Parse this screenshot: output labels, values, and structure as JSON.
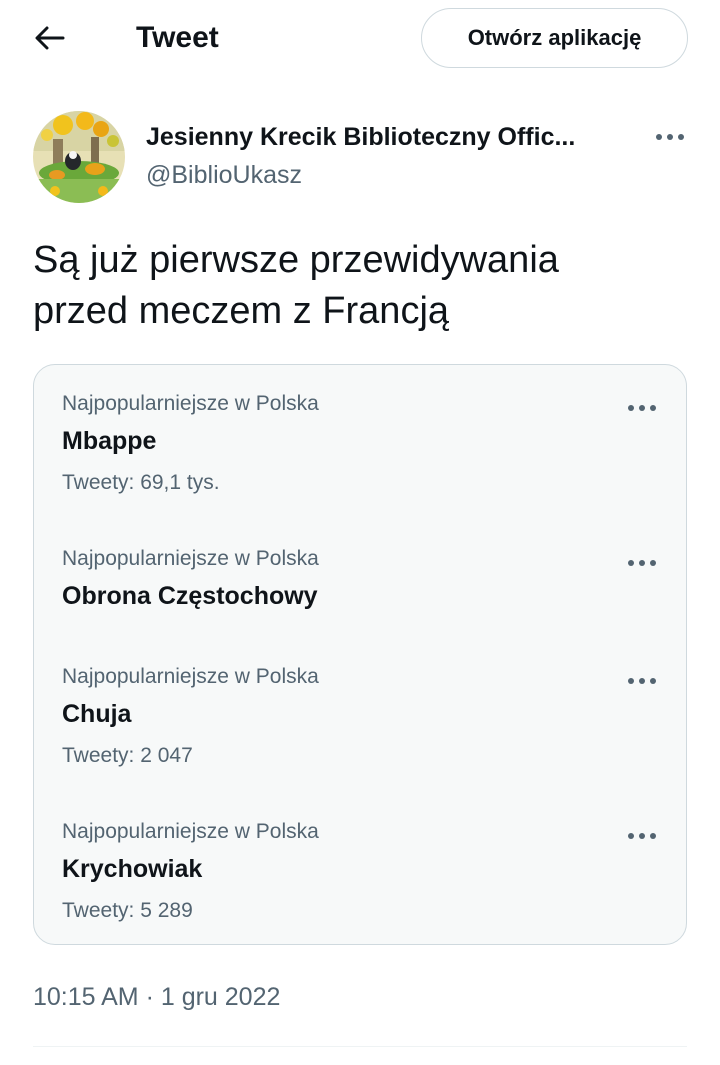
{
  "header": {
    "title": "Tweet",
    "open_app_label": "Otwórz aplikację",
    "back_icon": "arrow-left-icon"
  },
  "tweet": {
    "author_name": "Jesienny Krecik Biblioteczny Offic...",
    "author_handle": "@BiblioUkasz",
    "text_line1": "Są już pierwsze przewidywania",
    "text_line2": "przed meczem z Francją",
    "timestamp": "10:15 AM · 1 gru 2022",
    "more_icon": "more-horizontal-icon"
  },
  "embed": {
    "trends": [
      {
        "context": "Najpopularniejsze w Polska",
        "name": "Mbappe",
        "count": "Tweety: 69,1 tys."
      },
      {
        "context": "Najpopularniejsze w Polska",
        "name": "Obrona Częstochowy",
        "count": ""
      },
      {
        "context": "Najpopularniejsze w Polska",
        "name": "Chuja",
        "count": "Tweety: 2 047"
      },
      {
        "context": "Najpopularniejsze w Polska",
        "name": "Krychowiak",
        "count": "Tweety: 5 289"
      }
    ]
  },
  "colors": {
    "text_primary": "#0f1419",
    "text_secondary": "#536471",
    "border": "#cfd9de",
    "card_background": "#f7f9f9"
  }
}
